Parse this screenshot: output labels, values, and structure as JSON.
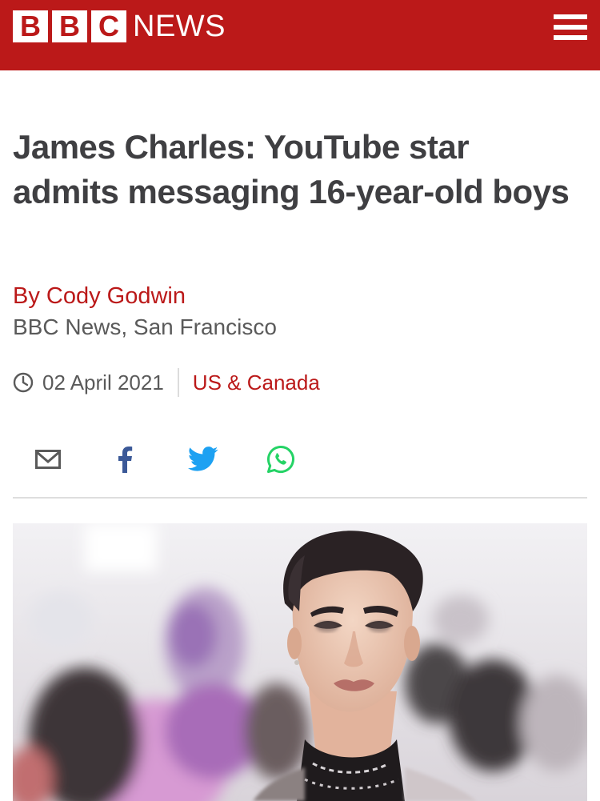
{
  "header": {
    "brand_letters": [
      "B",
      "B",
      "C"
    ],
    "brand_word": "NEWS",
    "menu_icon": "hamburger-menu-icon",
    "bar_color": "#bb1919"
  },
  "article": {
    "headline": "James Charles: YouTube star admits messaging 16-year-old boys",
    "author": "By Cody Godwin",
    "author_role": "BBC News, San Francisco",
    "date": "02 April 2021",
    "section": "US & Canada"
  },
  "share": {
    "icons": [
      "email-icon",
      "facebook-icon",
      "twitter-icon",
      "whatsapp-icon"
    ],
    "facebook_color": "#3b5998",
    "twitter_color": "#1da1f2",
    "whatsapp_color": "#25d366"
  },
  "hero_image": {
    "subject": "photo"
  }
}
